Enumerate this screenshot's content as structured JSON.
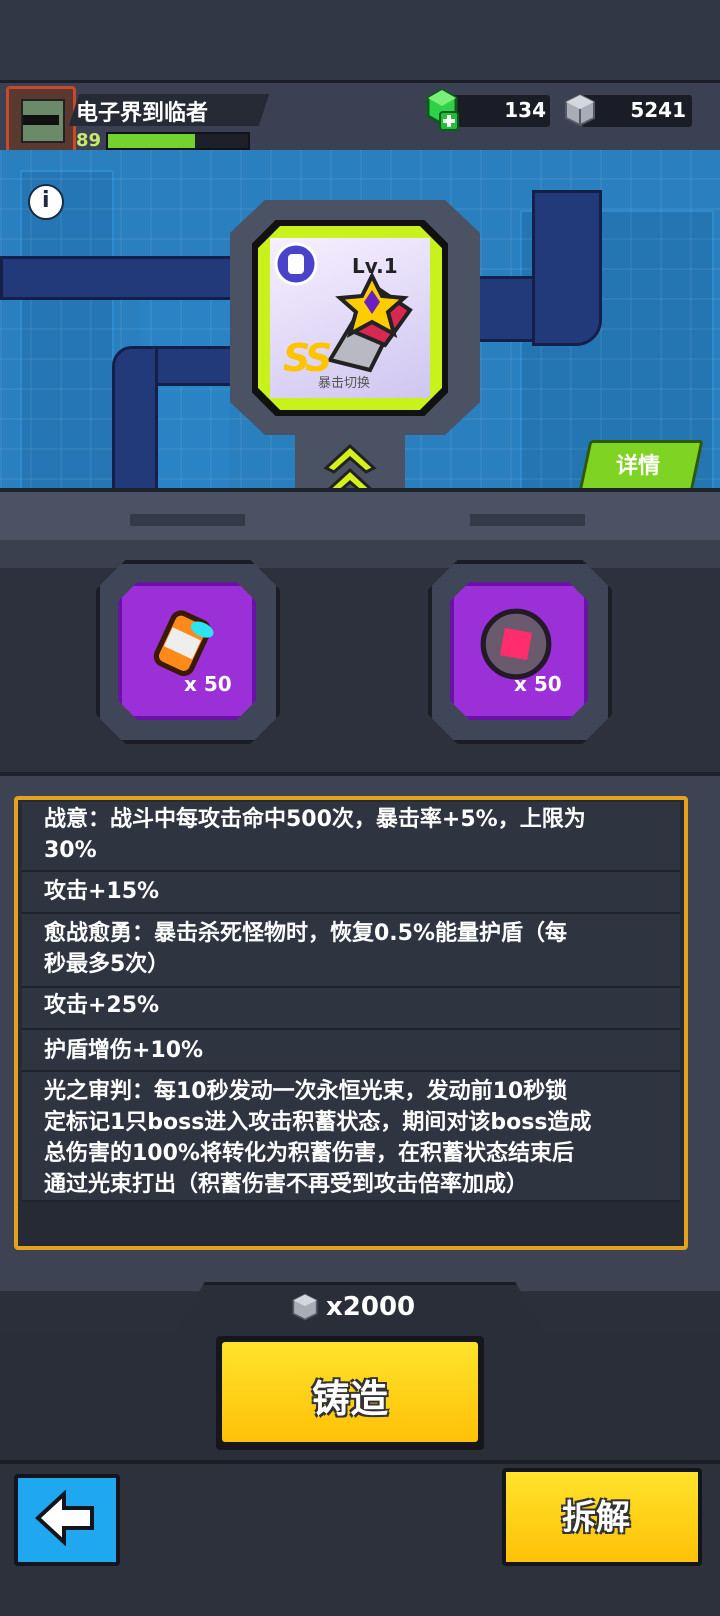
{
  "player": {
    "name": "电子界到临者",
    "level": "89",
    "xp_fraction": 0.62
  },
  "currencies": {
    "gems": {
      "value": "134",
      "icon": "green-gem-plus-icon"
    },
    "metal": {
      "value": "5241",
      "icon": "metal-cube-icon"
    }
  },
  "materials_bar": [
    {
      "icon": "purple-crystal-icon",
      "value": "50"
    },
    {
      "icon": "red-core-orb-icon",
      "value": "50"
    },
    {
      "icon": "orange-capsule-icon",
      "value": "50"
    }
  ],
  "item": {
    "level": "Lv.1",
    "rank": "SS",
    "name": "暴击切换",
    "type_icon": "glove-icon"
  },
  "buttons": {
    "details": "详情",
    "forge": "铸造",
    "dismantle": "拆解"
  },
  "required_materials": [
    {
      "icon": "orange-capsule-icon",
      "count": "x 50"
    },
    {
      "icon": "red-core-orb-icon",
      "count": "x 50"
    }
  ],
  "effects": [
    {
      "text_lines": [
        "战意：战斗中每攻击命中500次，暴击率+5%，上限为",
        "30%"
      ]
    },
    {
      "text_lines": [
        "攻击+15%"
      ]
    },
    {
      "text_lines": [
        "愈战愈勇：暴击杀死怪物时，恢复0.5%能量护盾（每",
        "秒最多5次）"
      ]
    },
    {
      "text_lines": [
        "攻击+25%"
      ]
    },
    {
      "text_lines": [
        "护盾增伤+10%"
      ]
    },
    {
      "text_lines": [
        "光之审判：每10秒发动一次永恒光束，发动前10秒锁",
        "定标记1只boss进入攻击积蓄状态，期间对该boss造成",
        "总伤害的100%将转化为积蓄伤害，在积蓄状态结束后",
        "通过光束打出（积蓄伤害不再受到攻击倍率加成）"
      ]
    }
  ],
  "cost": {
    "icon": "metal-cube-icon",
    "label": "x2000"
  },
  "colors": {
    "accent_lime": "#c9f21c",
    "button_yellow": "#ffc107",
    "panel_border": "#e4a21e",
    "back_blue": "#1fa8ef"
  }
}
